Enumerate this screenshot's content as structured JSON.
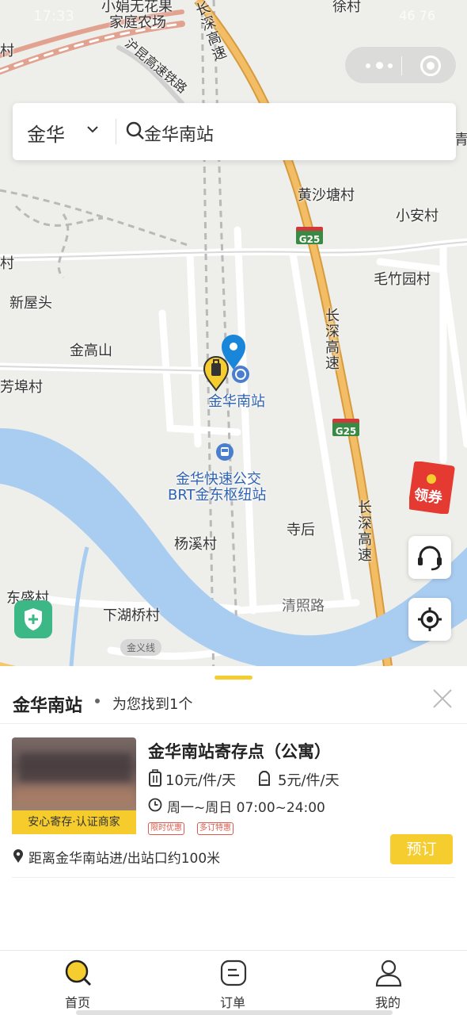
{
  "status_bar": {
    "time": "17:33",
    "right_text": "46 76"
  },
  "map": {
    "labels": [
      {
        "text": "小娟无花果",
        "kind": "normal"
      },
      {
        "text": "家庭农场",
        "kind": "normal"
      },
      {
        "text": "徐村",
        "kind": "normal"
      },
      {
        "text": "沪昆高速铁路",
        "kind": "normal"
      },
      {
        "text": "长深高速",
        "kind": "normal"
      },
      {
        "text": "黄沙塘村",
        "kind": "normal"
      },
      {
        "text": "小安村",
        "kind": "normal"
      },
      {
        "text": "毛竹园村",
        "kind": "normal"
      },
      {
        "text": "新屋头",
        "kind": "normal"
      },
      {
        "text": "金高山",
        "kind": "normal"
      },
      {
        "text": "芳埠村",
        "kind": "normal"
      },
      {
        "text": "金华南站",
        "kind": "blue"
      },
      {
        "text": "金华快速公交",
        "kind": "blue"
      },
      {
        "text": "BRT金东枢纽站",
        "kind": "blue"
      },
      {
        "text": "寺后",
        "kind": "normal"
      },
      {
        "text": "杨溪村",
        "kind": "normal"
      },
      {
        "text": "东盛村",
        "kind": "normal"
      },
      {
        "text": "下湖桥村",
        "kind": "normal"
      },
      {
        "text": "清照路",
        "kind": "normal"
      },
      {
        "text": "长深高速",
        "kind": "normal"
      },
      {
        "text": "长深高速",
        "kind": "normal"
      },
      {
        "text": "青",
        "kind": "normal"
      },
      {
        "text": "村",
        "kind": "normal"
      },
      {
        "text": "村",
        "kind": "normal"
      }
    ],
    "highway_shields": [
      "G25",
      "G25"
    ],
    "road_badge": "金义线",
    "coupon_text": "领券"
  },
  "search": {
    "city": "金华",
    "query": "金华南站"
  },
  "results": {
    "title": "金华南站",
    "summary": "为您找到1个",
    "items": [
      {
        "name": "金华南站寄存点（公寓）",
        "photo_badge": "安心寄存·认证商家",
        "price_suitcase": "10元/件/天",
        "price_backpack": "5元/件/天",
        "hours": "周一~周日 07:00~24:00",
        "tags": [
          "限时优惠",
          "多订特惠"
        ],
        "book_label": "预订",
        "distance": "距离金华南站进/出站口约100米"
      }
    ]
  },
  "tabbar": {
    "tabs": [
      {
        "label": "首页",
        "icon": "search-icon",
        "active": true
      },
      {
        "label": "订单",
        "icon": "order-icon",
        "active": false
      },
      {
        "label": "我的",
        "icon": "profile-icon",
        "active": false
      }
    ]
  },
  "colors": {
    "accent": "#f5cd2f",
    "pin_blue": "#1a86d9",
    "river": "#a9cdf1",
    "highway": "#f0b45a",
    "tag_red": "#e05b4d",
    "safety_green": "#3cb887"
  }
}
